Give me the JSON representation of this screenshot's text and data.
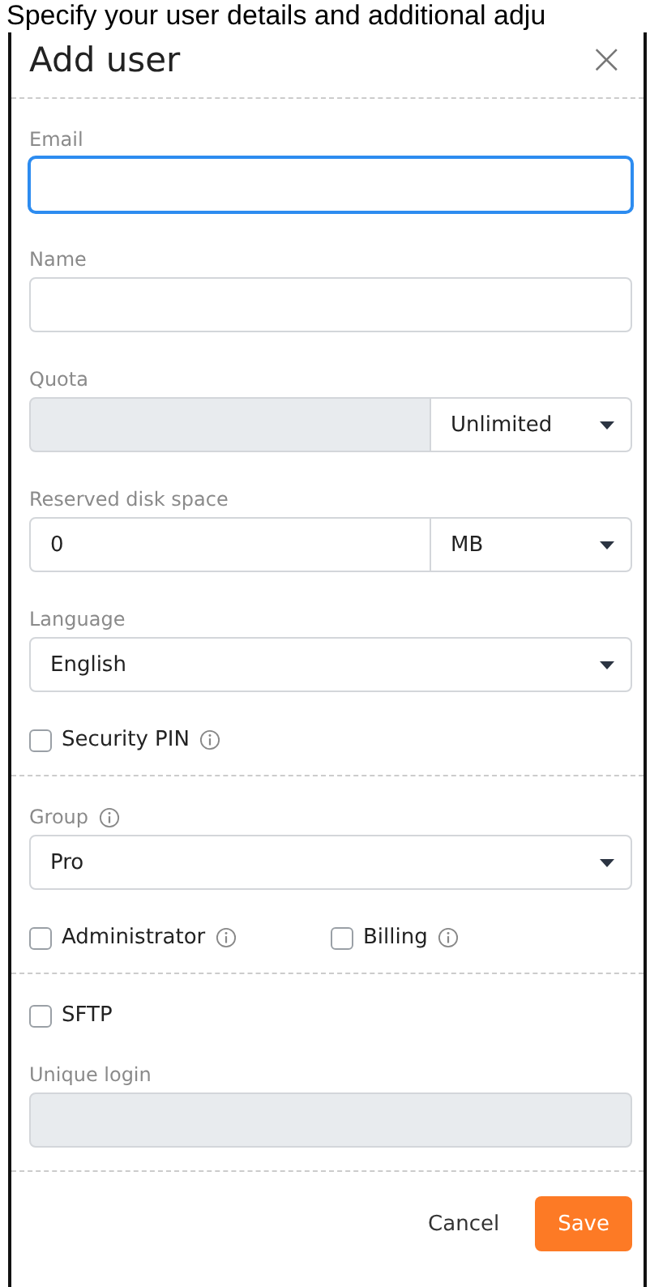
{
  "background_text": "Specify your user details and additional adju",
  "dialog": {
    "title": "Add user",
    "close": "×",
    "sections": [
      {
        "items": [
          {
            "kind": "input",
            "label": "Email",
            "value": "",
            "focused": true,
            "disabled": false
          },
          {
            "kind": "input",
            "label": "Name",
            "value": "",
            "focused": false,
            "disabled": false
          },
          {
            "kind": "split",
            "label": "Quota",
            "value": "",
            "disabled": true,
            "option": "Unlimited"
          },
          {
            "kind": "split",
            "label": "Reserved disk space",
            "value": "0",
            "disabled": false,
            "option": "MB"
          },
          {
            "kind": "select",
            "label": "Language",
            "option": "English",
            "info": false
          },
          {
            "kind": "checks",
            "checks": [
              {
                "label": "Security PIN",
                "checked": false,
                "info": true
              }
            ]
          }
        ]
      },
      {
        "items": [
          {
            "kind": "select",
            "label": "Group",
            "option": "Pro",
            "info": true
          },
          {
            "kind": "checks",
            "checks": [
              {
                "label": "Administrator",
                "checked": false,
                "info": true
              },
              {
                "label": "Billing",
                "checked": false,
                "info": true
              }
            ]
          }
        ]
      },
      {
        "items": [
          {
            "kind": "checks",
            "checks": [
              {
                "label": "SFTP",
                "checked": false,
                "info": false
              }
            ]
          },
          {
            "kind": "input",
            "label": "Unique login",
            "value": "",
            "focused": false,
            "disabled": true
          }
        ]
      }
    ],
    "buttons": [
      {
        "kind": "secondary",
        "label": "Cancel"
      },
      {
        "kind": "primary",
        "label": "Save"
      }
    ]
  }
}
